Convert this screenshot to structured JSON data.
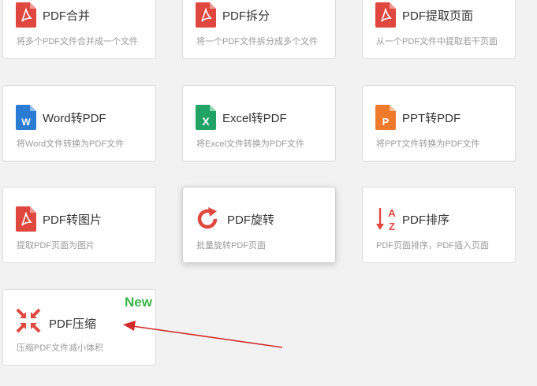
{
  "cards": [
    {
      "title": "PDF合并",
      "desc": "将多个PDF文件合并成一个文件",
      "icon": "pdf-file-icon"
    },
    {
      "title": "PDF拆分",
      "desc": "将一个PDF文件拆分成多个文件",
      "icon": "pdf-file-icon"
    },
    {
      "title": "PDF提取页面",
      "desc": "从一个PDF文件中提取若干页面",
      "icon": "pdf-file-icon"
    },
    {
      "title": "Word转PDF",
      "desc": "将Word文件转换为PDF文件",
      "icon": "word-file-icon"
    },
    {
      "title": "Excel转PDF",
      "desc": "将Excel文件转换为PDF文件",
      "icon": "excel-file-icon"
    },
    {
      "title": "PPT转PDF",
      "desc": "将PPT文件转换为PDF文件",
      "icon": "ppt-file-icon"
    },
    {
      "title": "PDF转图片",
      "desc": "提取PDF页面为图片",
      "icon": "pdf-file-icon"
    },
    {
      "title": "PDF旋转",
      "desc": "批量旋转PDF页面",
      "icon": "rotate-icon"
    },
    {
      "title": "PDF排序",
      "desc": "PDF页面排序，PDF插入页面",
      "icon": "sort-az-icon"
    },
    {
      "title": "PDF压缩",
      "desc": "压缩PDF文件减小体积",
      "icon": "compress-icon",
      "badge": "New"
    }
  ],
  "colors": {
    "pdf_red": "#e0483f",
    "word_blue": "#2b7cd3",
    "excel_green": "#21a366",
    "ppt_orange": "#f07a2b",
    "badge_green": "#3bb54a",
    "arrow_red": "#d42a2a"
  }
}
